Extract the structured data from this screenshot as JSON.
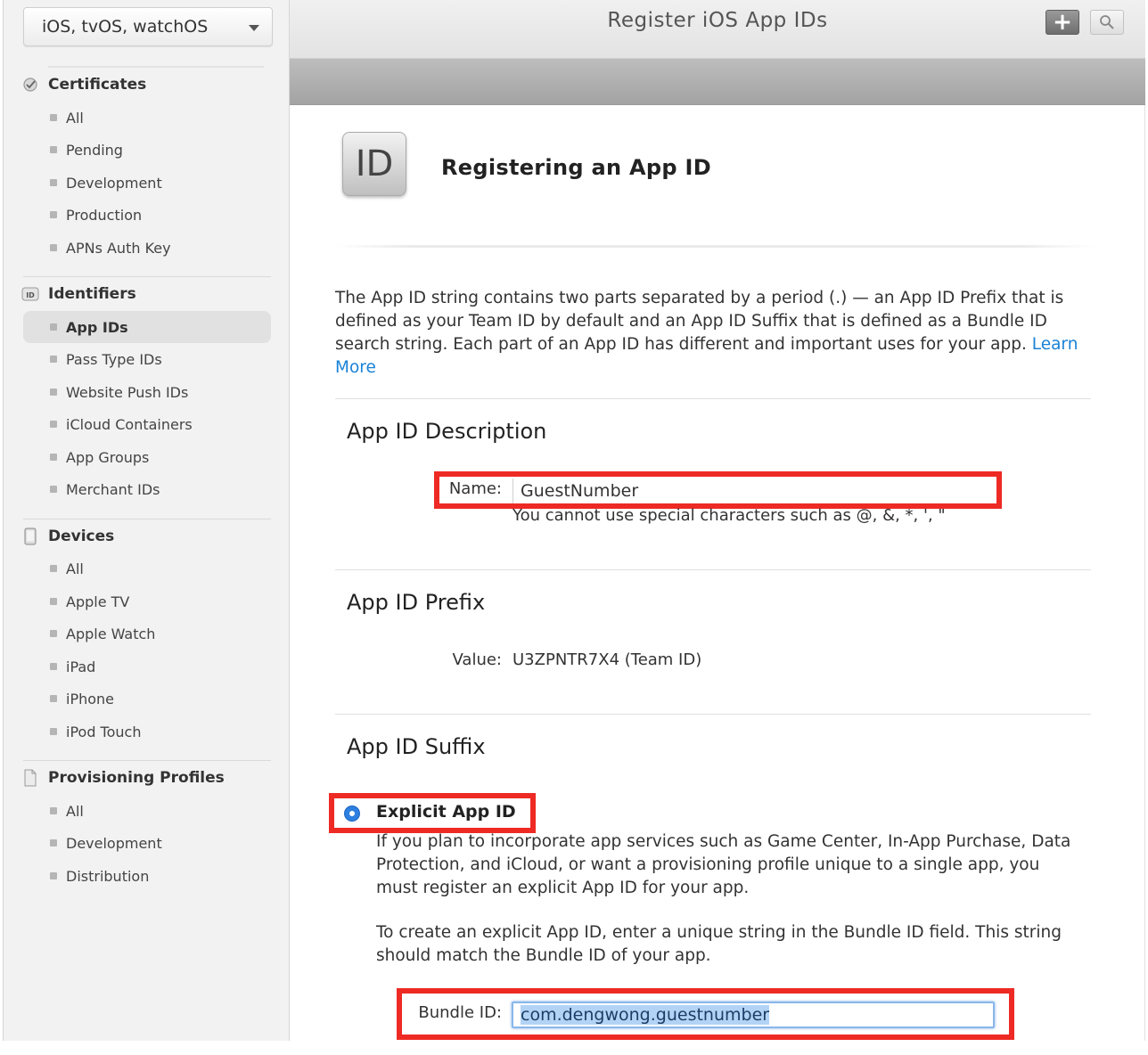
{
  "sidebar": {
    "platform": "iOS, tvOS, watchOS",
    "certificates": {
      "title": "Certificates",
      "items": [
        "All",
        "Pending",
        "Development",
        "Production",
        "APNs Auth Key"
      ]
    },
    "identifiers": {
      "title": "Identifiers",
      "icon_text": "ID",
      "items": [
        "App IDs",
        "Pass Type IDs",
        "Website Push IDs",
        "iCloud Containers",
        "App Groups",
        "Merchant IDs"
      ],
      "active": "App IDs"
    },
    "devices": {
      "title": "Devices",
      "items": [
        "All",
        "Apple TV",
        "Apple Watch",
        "iPad",
        "iPhone",
        "iPod Touch"
      ]
    },
    "profiles": {
      "title": "Provisioning Profiles",
      "items": [
        "All",
        "Development",
        "Distribution"
      ]
    }
  },
  "toolbar": {
    "title": "Register iOS App IDs",
    "add_label": "+"
  },
  "page": {
    "icon_text": "ID",
    "heading": "Registering an App ID",
    "intro": "The App ID string contains two parts separated by a period (.) — an App ID Prefix that is defined as your Team ID by default and an App ID Suffix that is defined as a Bundle ID search string. Each part of an App ID has different and important uses for your app.",
    "learn_more": "Learn More"
  },
  "description": {
    "title": "App ID Description",
    "name_label": "Name:",
    "name_value": "GuestNumber",
    "hint": "You cannot use special characters such as @, &, *, ', \""
  },
  "prefix": {
    "title": "App ID Prefix",
    "value_label": "Value:",
    "value": "U3ZPNTR7X4 (Team ID)"
  },
  "suffix": {
    "title": "App ID Suffix",
    "explicit_label": "Explicit App ID",
    "explicit_desc": "If you plan to incorporate app services such as Game Center, In-App Purchase, Data Protection, and iCloud, or want a provisioning profile unique to a single app, you must register an explicit App ID for your app.",
    "explicit_instr": "To create an explicit App ID, enter a unique string in the Bundle ID field. This string should match the Bundle ID of your app.",
    "bundle_label": "Bundle ID:",
    "bundle_value": "com.dengwong.guestnumber"
  },
  "colors": {
    "highlight_box": "#ee2a24",
    "link": "#1a82d6",
    "radio": "#2d7fe0"
  }
}
